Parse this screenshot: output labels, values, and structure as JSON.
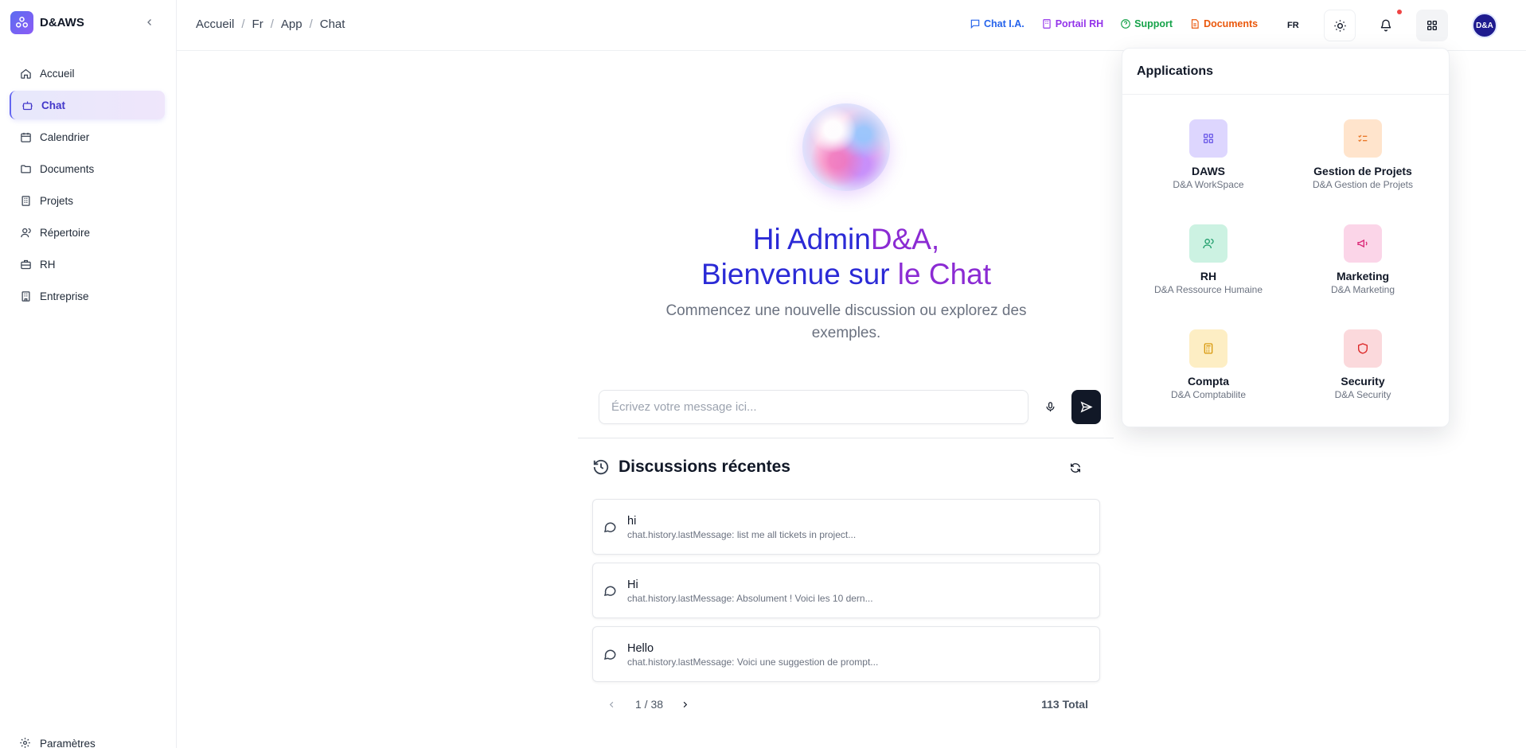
{
  "brand": {
    "name": "D&AWS"
  },
  "sidebar": {
    "items": [
      {
        "label": "Accueil",
        "icon": "home-icon"
      },
      {
        "label": "Chat",
        "icon": "bot-icon",
        "active": true
      },
      {
        "label": "Calendrier",
        "icon": "calendar-icon"
      },
      {
        "label": "Documents",
        "icon": "folder-icon"
      },
      {
        "label": "Projets",
        "icon": "building-icon"
      },
      {
        "label": "Répertoire",
        "icon": "users-icon"
      },
      {
        "label": "RH",
        "icon": "briefcase-icon"
      },
      {
        "label": "Entreprise",
        "icon": "building-icon"
      }
    ],
    "settings_label": "Paramètres"
  },
  "header": {
    "breadcrumb": [
      "Accueil",
      "Fr",
      "App",
      "Chat"
    ],
    "separator": "/",
    "quick_links": {
      "chat": "Chat I.A.",
      "rh": "Portail RH",
      "support": "Support",
      "documents": "Documents"
    },
    "language": "FR",
    "avatar_text": "D&A"
  },
  "main": {
    "greeting_prefix": "Hi Admin",
    "greeting_name": "D&A,",
    "welcome_prefix": "Bienvenue sur ",
    "welcome_suffix": "le Chat",
    "subtitle": "Commencez une nouvelle discussion ou explorez des exemples.",
    "input_placeholder": "Écrivez votre message ici...",
    "recent_title": "Discussions récentes",
    "conversations": [
      {
        "title": "hi",
        "last": "chat.history.lastMessage: list me all tickets in project..."
      },
      {
        "title": "Hi",
        "last": "chat.history.lastMessage: Absolument ! Voici les 10 dern..."
      },
      {
        "title": "Hello",
        "last": "chat.history.lastMessage: Voici une suggestion de prompt..."
      }
    ],
    "pagination": {
      "page_text": "1 / 38",
      "total_text": "113 Total"
    }
  },
  "apps_panel": {
    "title": "Applications",
    "apps": [
      {
        "name": "DAWS",
        "sub": "D&A WorkSpace",
        "icon": "grid-icon",
        "bg": "#ddd6fe",
        "fg": "#6d5ce8"
      },
      {
        "name": "Gestion de Projets",
        "sub": "D&A Gestion de Projets",
        "icon": "list-check-icon",
        "bg": "#ffe4cc",
        "fg": "#ea7a2c"
      },
      {
        "name": "RH",
        "sub": "D&A Ressource Humaine",
        "icon": "users-icon",
        "bg": "#ccf2e2",
        "fg": "#1f9d6b"
      },
      {
        "name": "Marketing",
        "sub": "D&A Marketing",
        "icon": "megaphone-icon",
        "bg": "#fbd5e8",
        "fg": "#db2777"
      },
      {
        "name": "Compta",
        "sub": "D&A Comptabilite",
        "icon": "calculator-icon",
        "bg": "#fdeec4",
        "fg": "#d99a10"
      },
      {
        "name": "Security",
        "sub": "D&A Security",
        "icon": "shield-icon",
        "bg": "#fbd9dc",
        "fg": "#dc2626"
      }
    ]
  },
  "colors": {
    "accent": "#4338ca",
    "purple": "#8b2bd3",
    "blue": "#2b2ad6"
  }
}
